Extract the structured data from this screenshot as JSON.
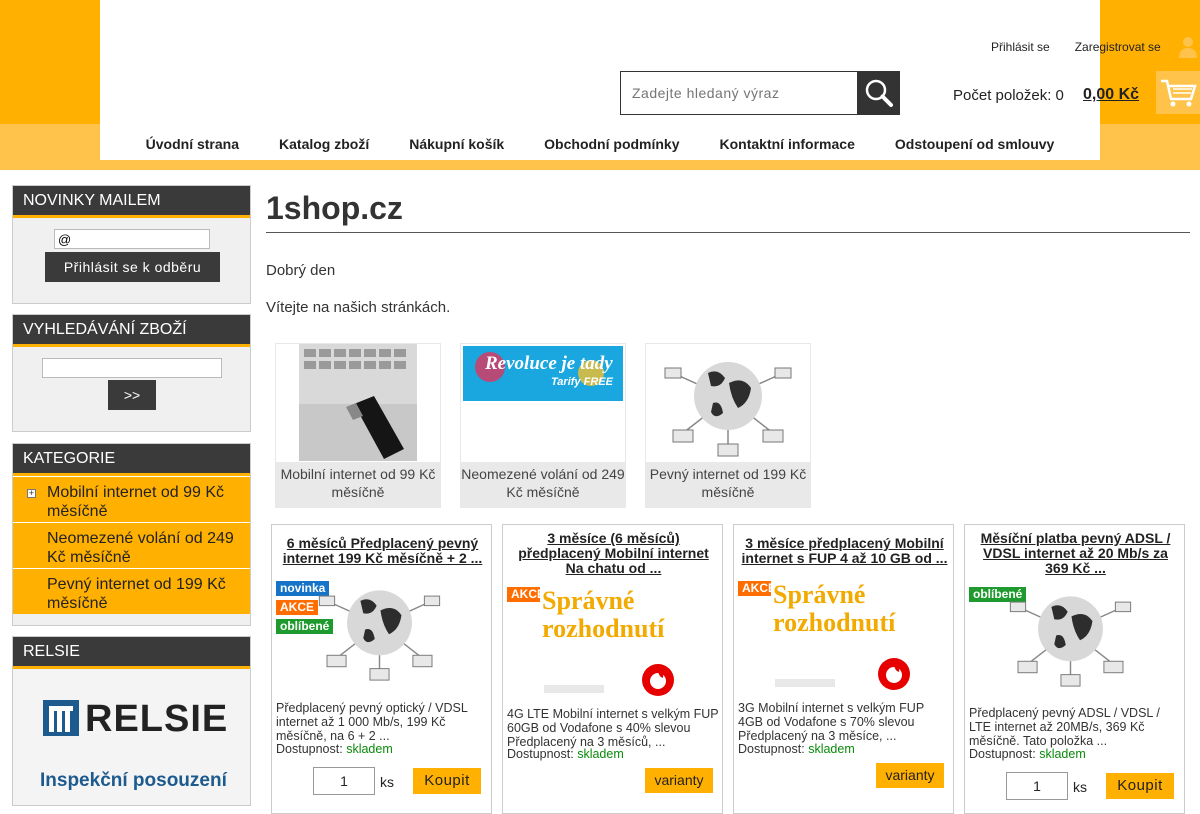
{
  "header": {
    "login_label": "Přihlásit se",
    "register_label": "Zaregistrovat se",
    "search_placeholder": "Zadejte hledaný výraz",
    "cart_count_label": "Počet položek: 0",
    "cart_total": "0,00 Kč"
  },
  "nav": [
    "Úvodní strana",
    "Katalog zboží",
    "Nákupní košík",
    "Obchodní podmínky",
    "Kontaktní informace",
    "Odstoupení od smlouvy"
  ],
  "sidebar": {
    "newsletter": {
      "title": "NOVINKY MAILEM",
      "input_value": "@",
      "button_label": "Přihlásit se k odběru"
    },
    "search": {
      "title": "VYHLEDÁVÁNÍ ZBOŽÍ",
      "button_label": ">>"
    },
    "categories": {
      "title": "KATEGORIE",
      "items": [
        "Mobilní internet od 99 Kč měsíčně",
        "Neomezené volání od 249 Kč měsíčně",
        "Pevný internet od 199 Kč měsíčně"
      ]
    },
    "partner": {
      "title": "RELSIE",
      "logo_text": "RELSIE",
      "tagline": "Inspekční posouzení"
    }
  },
  "main": {
    "title": "1shop.cz",
    "greeting": "Dobrý den",
    "welcome": "Vítejte na našich stránkách.",
    "banner_text": "Revoluce je tady",
    "banner_sub": "Tarify FREE",
    "tiles": [
      "Mobilní internet od 99 Kč měsíčně",
      "Neomezené volání od 249 Kč měsíčně",
      "Pevný internet od 199 Kč měsíčně"
    ]
  },
  "products": [
    {
      "title": "6 měsíců Předplacený pevný internet 199 Kč měsíčně + 2 ...",
      "badges": [
        "novinka",
        "AKCE",
        "oblíbené"
      ],
      "desc": "Předplacený pevný optický / VDSL internet až 1 000 Mb/s, 199 Kč měsíčně, na 6 + 2 ...",
      "avail_label": "Dostupnost:",
      "avail_value": "skladem",
      "qty": "1",
      "unit": "ks",
      "button": "Koupit"
    },
    {
      "title": "3 měsíce (6 měsíců) předplacený Mobilní internet Na chatu od ...",
      "badges": [
        "AKCE"
      ],
      "promo_text": "Správné rozhodnutí",
      "desc": "4G LTE Mobilní internet s velkým FUP 60GB od Vodafone s 40% slevou Předplacený na 3 měsíců, ...",
      "avail_label": "Dostupnost:",
      "avail_value": "skladem",
      "button": "varianty"
    },
    {
      "title": "3 měsíce předplacený Mobilní internet s FUP 4 až 10 GB od ...",
      "badges": [
        "AKCE"
      ],
      "promo_text": "Správné rozhodnutí",
      "desc": "3G Mobilní internet s velkým FUP 4GB od Vodafone s 70% slevou Předplacený na 3 měsíce, ...",
      "avail_label": "Dostupnost:",
      "avail_value": "skladem",
      "button": "varianty"
    },
    {
      "title": "Měsíční platba pevný ADSL / VDSL internet až 20 Mb/s za 369 Kč ...",
      "badges": [
        "oblíbené"
      ],
      "desc": "Předplacený pevný ADSL / VDSL / LTE internet až 20MB/s, 369 Kč měsíčně. Tato položka ...",
      "avail_label": "Dostupnost:",
      "avail_value": "skladem",
      "qty": "1",
      "unit": "ks",
      "button": "Koupit"
    }
  ],
  "colors": {
    "accent": "#ffb000",
    "accent_light": "#ffc24a",
    "dark": "#3a3a3a",
    "in_stock": "#0a8a0a"
  }
}
